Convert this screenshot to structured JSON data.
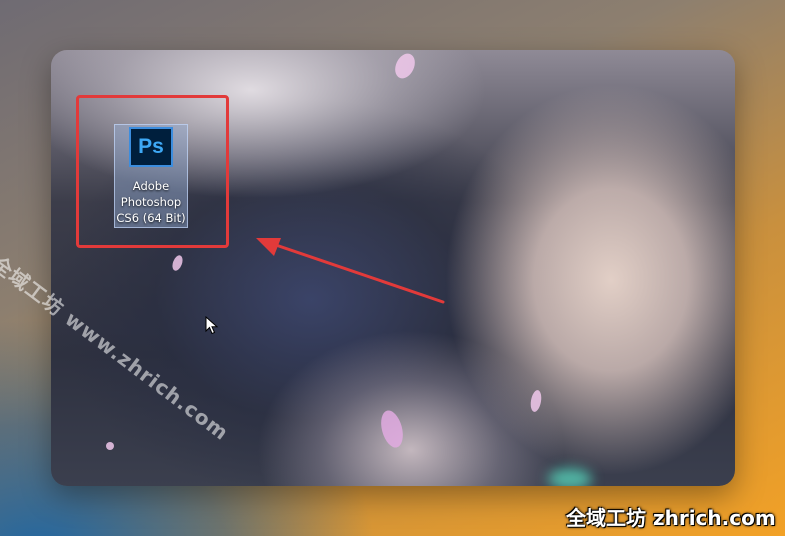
{
  "desktop": {
    "icon": {
      "logo_text": "Ps",
      "label_lines": [
        "Adobe",
        "Photoshop",
        "CS6 (64 Bit)"
      ]
    }
  },
  "annotations": {
    "highlight_color": "#e23a3a",
    "arrow_color": "#e23a3a"
  },
  "watermarks": {
    "diagonal": "全域工坊 www.zhrich.com",
    "corner": "全域工坊 zhrich.com"
  }
}
